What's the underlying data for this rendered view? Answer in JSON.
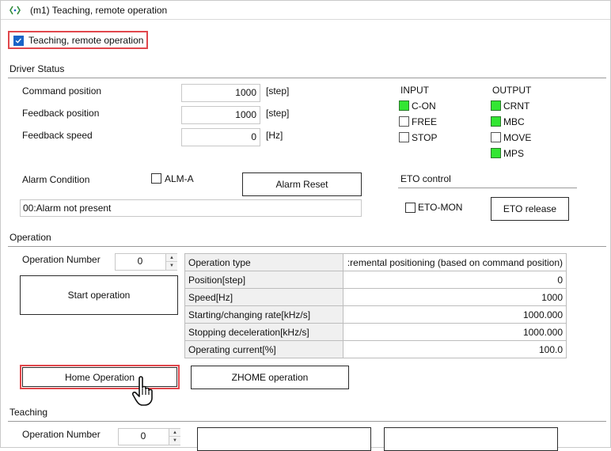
{
  "window": {
    "title": "(m1) Teaching, remote operation"
  },
  "enable": {
    "label": "Teaching, remote operation",
    "checked": true
  },
  "driver_status": {
    "section_title": "Driver Status",
    "command_position": {
      "label": "Command position",
      "value": "1000",
      "unit": "[step]"
    },
    "feedback_position": {
      "label": "Feedback position",
      "value": "1000",
      "unit": "[step]"
    },
    "feedback_speed": {
      "label": "Feedback speed",
      "value": "0",
      "unit": "[Hz]"
    },
    "input": {
      "title": "INPUT",
      "items": [
        {
          "label": "C-ON",
          "on": true
        },
        {
          "label": "FREE",
          "on": false
        },
        {
          "label": "STOP",
          "on": false
        }
      ]
    },
    "output": {
      "title": "OUTPUT",
      "items": [
        {
          "label": "CRNT",
          "on": true
        },
        {
          "label": "MBC",
          "on": true
        },
        {
          "label": "MOVE",
          "on": false
        },
        {
          "label": "MPS",
          "on": true
        }
      ]
    },
    "alarm": {
      "label": "Alarm Condition",
      "alm_a_label": "ALM-A",
      "alm_a_checked": false,
      "reset_button": "Alarm Reset",
      "status_text": "00:Alarm not present"
    },
    "eto": {
      "title": "ETO control",
      "mon_label": "ETO-MON",
      "mon_checked": false,
      "release_button": "ETO release"
    }
  },
  "operation": {
    "section_title": "Operation",
    "number_label": "Operation Number",
    "number_value": "0",
    "start_button": "Start operation",
    "home_button": "Home Operation",
    "zhome_button": "ZHOME operation",
    "table": [
      {
        "key": "Operation type",
        "value": ":remental positioning (based on command position)"
      },
      {
        "key": "Position[step]",
        "value": "0"
      },
      {
        "key": "Speed[Hz]",
        "value": "1000"
      },
      {
        "key": "Starting/changing rate[kHz/s]",
        "value": "1000.000"
      },
      {
        "key": "Stopping deceleration[kHz/s]",
        "value": "1000.000"
      },
      {
        "key": "Operating current[%]",
        "value": "100.0"
      }
    ]
  },
  "teaching": {
    "section_title": "Teaching",
    "number_label": "Operation Number",
    "number_value": "0"
  },
  "colors": {
    "highlight": "#e0474c",
    "led_on": "#33e633",
    "checkbox": "#1a64c8"
  }
}
